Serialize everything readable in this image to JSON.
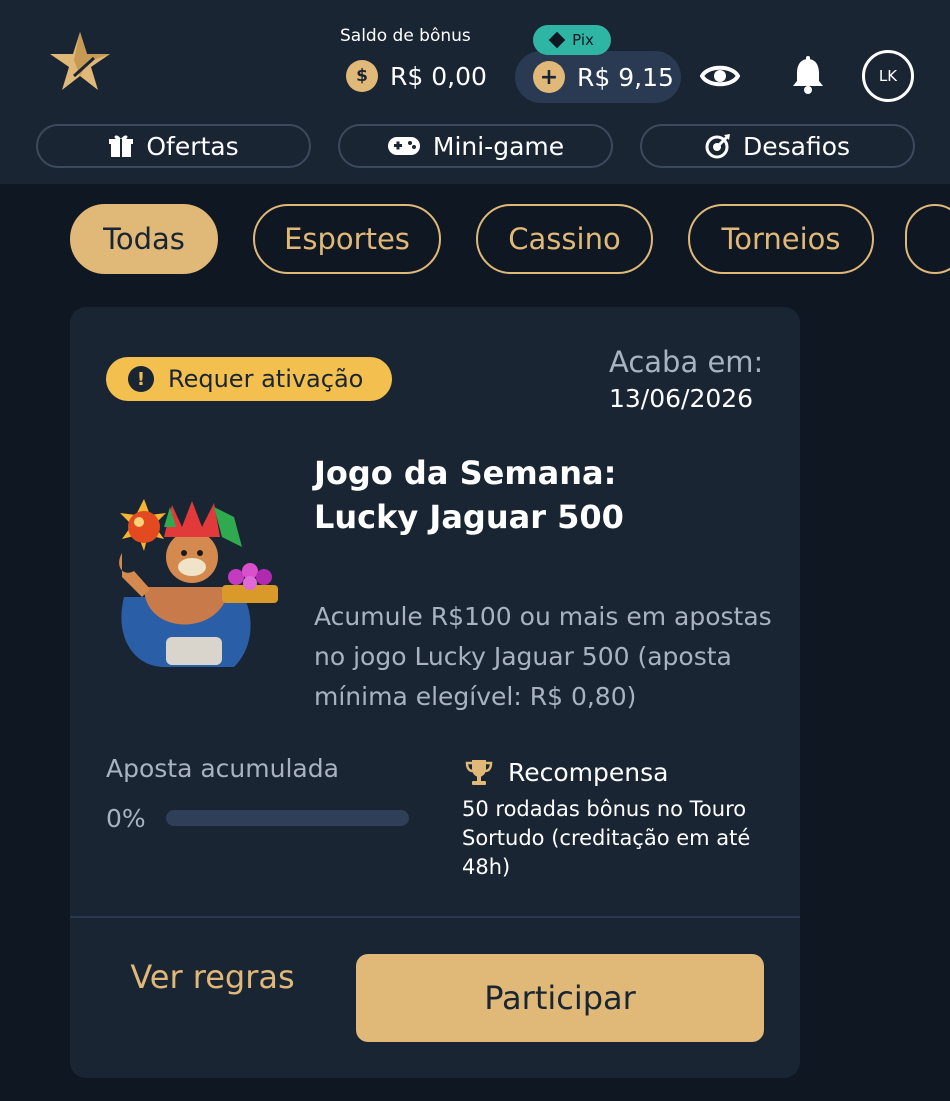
{
  "header": {
    "bonus_balance_label": "Saldo de bônus",
    "bonus_balance_value": "R$ 0,00",
    "wallet_badge": "Pix",
    "wallet_balance_value": "R$ 9,15",
    "avatar_initials": "LK",
    "icons": {
      "logo": "star-logo-icon",
      "bonus_coin": "coin-icon",
      "wallet_add": "plus-coin-icon",
      "pix": "pix-icon",
      "visibility": "eye-icon",
      "notifications": "bell-icon"
    }
  },
  "nav": [
    {
      "label": "Ofertas",
      "icon": "gift-icon"
    },
    {
      "label": "Mini-game",
      "icon": "gamepad-icon"
    },
    {
      "label": "Desafios",
      "icon": "target-icon"
    }
  ],
  "filters": [
    {
      "label": "Todas",
      "active": true
    },
    {
      "label": "Esportes",
      "active": false
    },
    {
      "label": "Cassino",
      "active": false
    },
    {
      "label": "Torneios",
      "active": false
    }
  ],
  "promo": {
    "status_badge": "Requer ativação",
    "ends_label": "Acaba em:",
    "ends_date": "13/06/2026",
    "title_line1": "Jogo da Semana:",
    "title_line2": "Lucky Jaguar 500",
    "description": "Acumule R$100 ou mais em apostas no jogo Lucky Jaguar 500 (aposta mínima elegível: R$ 0,80)",
    "accumulated_label": "Aposta acumulada",
    "progress_text": "0%",
    "progress_value": 0,
    "reward_label": "Recompensa",
    "reward_text": "50 rodadas bônus no Touro Sortudo (creditação em até 48h)",
    "rules_link": "Ver regras",
    "join_button": "Participar"
  },
  "colors": {
    "background": "#0f1822",
    "panel": "#1a2533",
    "accent_gold": "#e0b877",
    "badge_yellow": "#f3c04f",
    "pix_teal": "#2fb5a4",
    "muted_text": "#a9b3c0"
  }
}
